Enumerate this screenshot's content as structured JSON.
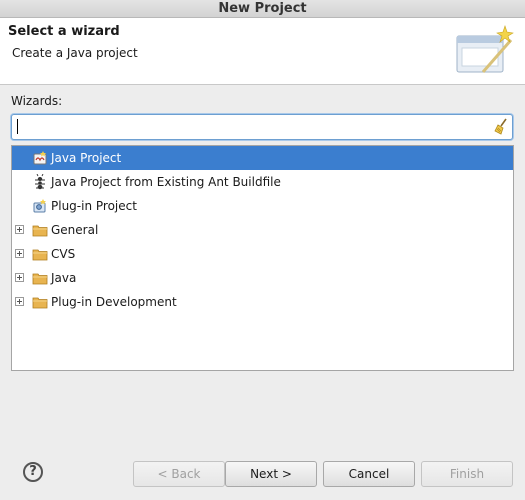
{
  "window": {
    "title": "New Project"
  },
  "header": {
    "title": "Select a wizard",
    "description": "Create a Java project"
  },
  "wizards_label": "Wizards:",
  "filter": {
    "value": "",
    "placeholder": ""
  },
  "tree": {
    "items": [
      {
        "label": "Java Project",
        "icon": "java-project-icon",
        "selected": true
      },
      {
        "label": "Java Project from Existing Ant Buildfile",
        "icon": "ant-icon",
        "selected": false
      },
      {
        "label": "Plug-in Project",
        "icon": "plugin-project-icon",
        "selected": false
      },
      {
        "label": "General",
        "icon": "folder-icon",
        "expandable": true
      },
      {
        "label": "CVS",
        "icon": "folder-icon",
        "expandable": true
      },
      {
        "label": "Java",
        "icon": "folder-icon",
        "expandable": true
      },
      {
        "label": "Plug-in Development",
        "icon": "folder-icon",
        "expandable": true
      }
    ]
  },
  "buttons": {
    "help": "?",
    "back": "< Back",
    "next": "Next >",
    "cancel": "Cancel",
    "finish": "Finish"
  },
  "colors": {
    "selection": "#3b7ecf",
    "folder": "#e8b450"
  }
}
